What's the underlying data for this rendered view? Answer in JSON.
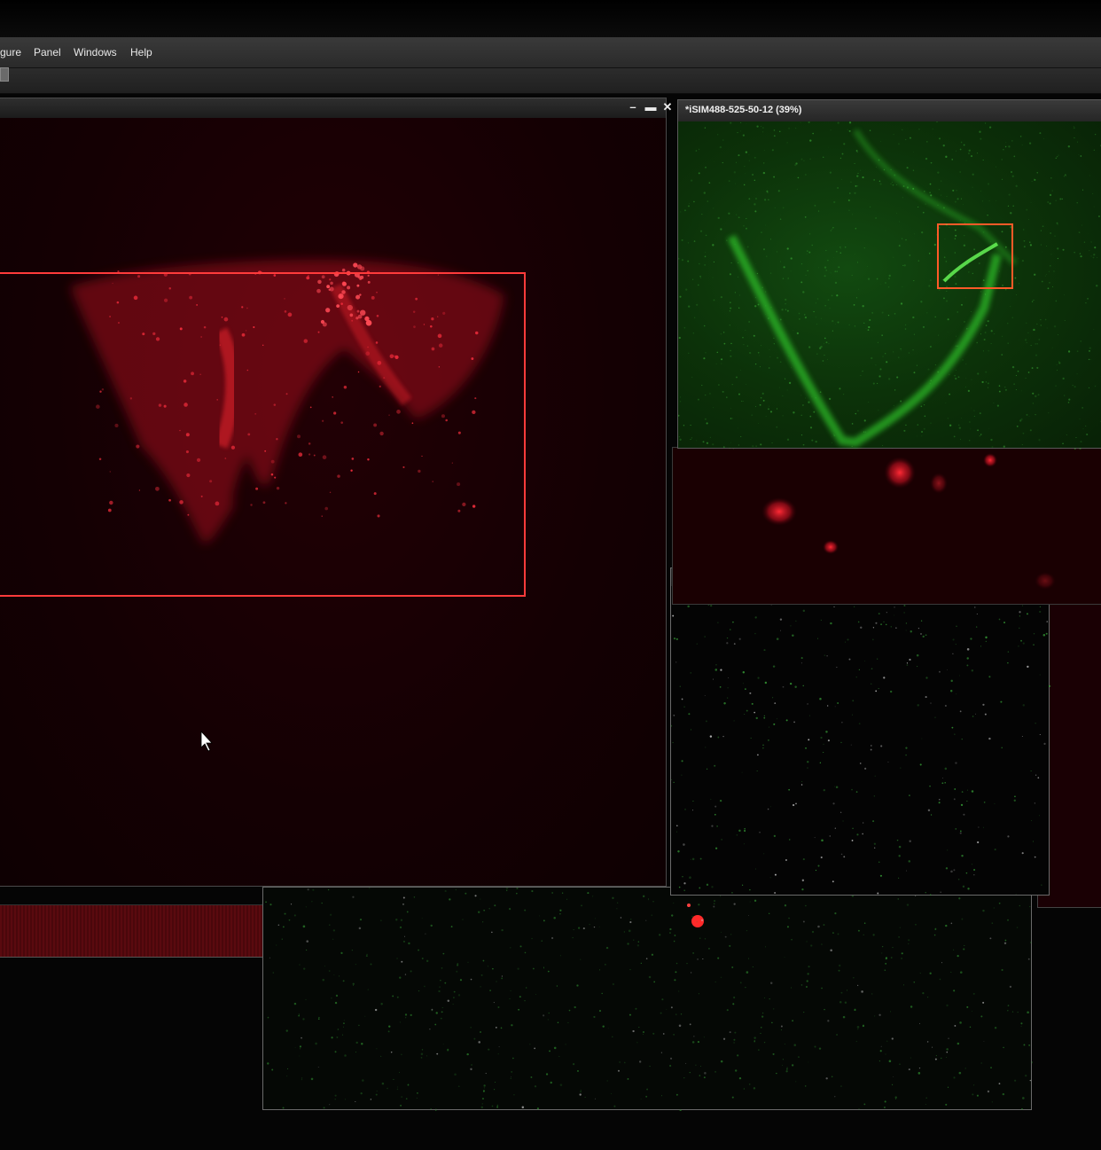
{
  "menu": {
    "items": [
      {
        "label": "gure"
      },
      {
        "label": "Panel"
      },
      {
        "label": "Windows"
      },
      {
        "label": "Help"
      }
    ]
  },
  "windows": {
    "red_main": {
      "controls": {
        "minimize": "–",
        "maximize": "▬",
        "close": "✕"
      }
    },
    "green": {
      "title": "*iSIM488-525-50-12 (39%)"
    },
    "black": {
      "controls": {
        "minimize": "–",
        "maximize": "▬",
        "close": "✕"
      }
    }
  },
  "colors": {
    "red_channel": "#ff2030",
    "green_channel": "#30e030",
    "roi_red": "#ff3b3b",
    "roi_orange": "#ff5a28"
  }
}
